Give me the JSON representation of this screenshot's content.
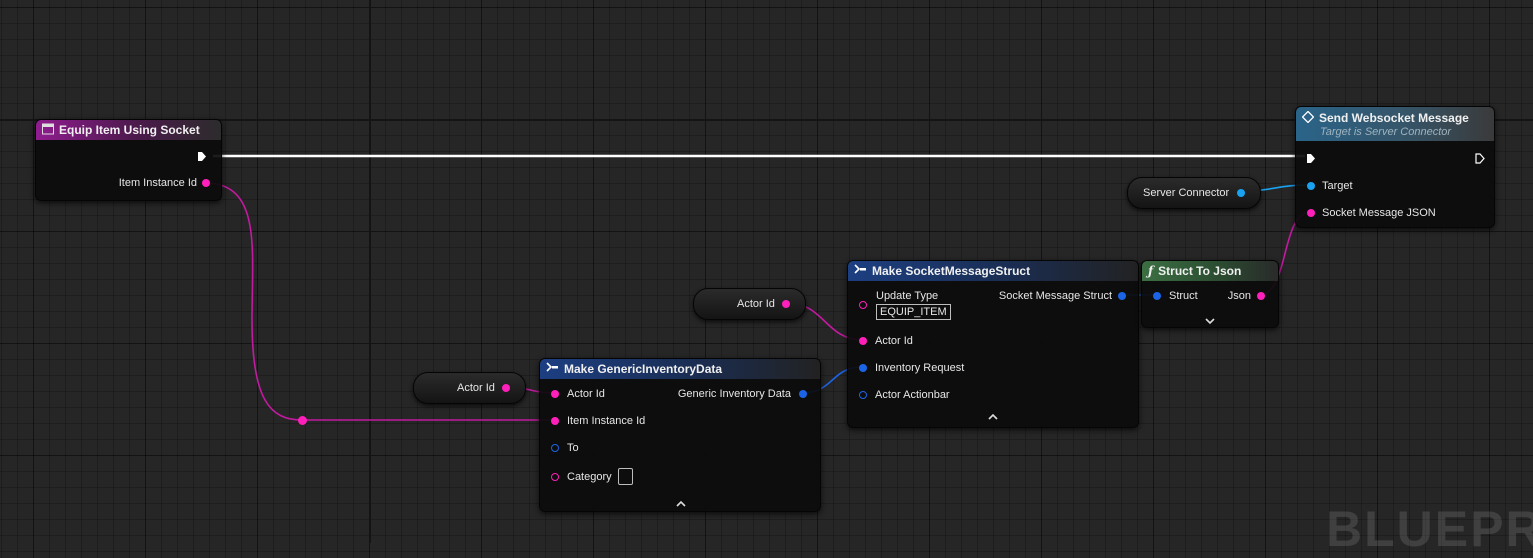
{
  "watermark": "BLUEPR",
  "nodes": {
    "equip": {
      "title": "Equip Item Using Socket",
      "icon": "event-icon",
      "pin_item_instance_id": "Item Instance Id"
    },
    "send": {
      "title": "Send Websocket Message",
      "subtitle": "Target is Server Connector",
      "icon": "function-diamond-icon",
      "pin_target": "Target",
      "pin_json": "Socket Message JSON"
    },
    "server_connector": {
      "label": "Server Connector"
    },
    "actor_id_var_top": {
      "label": "Actor Id"
    },
    "actor_id_var_bottom": {
      "label": "Actor Id"
    },
    "make_socket": {
      "title": "Make SocketMessageStruct",
      "icon": "make-struct-icon",
      "pin_update_type": "Update Type",
      "update_type_value": "EQUIP_ITEM",
      "pin_socket_message_struct": "Socket Message Struct",
      "pin_actor_id": "Actor Id",
      "pin_inventory_request": "Inventory Request",
      "pin_actor_actionbar": "Actor Actionbar"
    },
    "struct_to_json": {
      "title": "Struct To Json",
      "icon": "function-icon",
      "pin_struct": "Struct",
      "pin_json": "Json"
    },
    "make_generic": {
      "title": "Make GenericInventoryData",
      "icon": "make-struct-icon",
      "pin_actor_id": "Actor Id",
      "pin_item_instance_id": "Item Instance Id",
      "pin_to": "To",
      "pin_category": "Category",
      "pin_generic_inventory_data": "Generic Inventory Data"
    }
  },
  "colors": {
    "exec_wire": "#ffffff",
    "string_pin": "#ff1fbb",
    "struct_pin": "#1c64e6",
    "object_pin": "#18a2f0"
  }
}
